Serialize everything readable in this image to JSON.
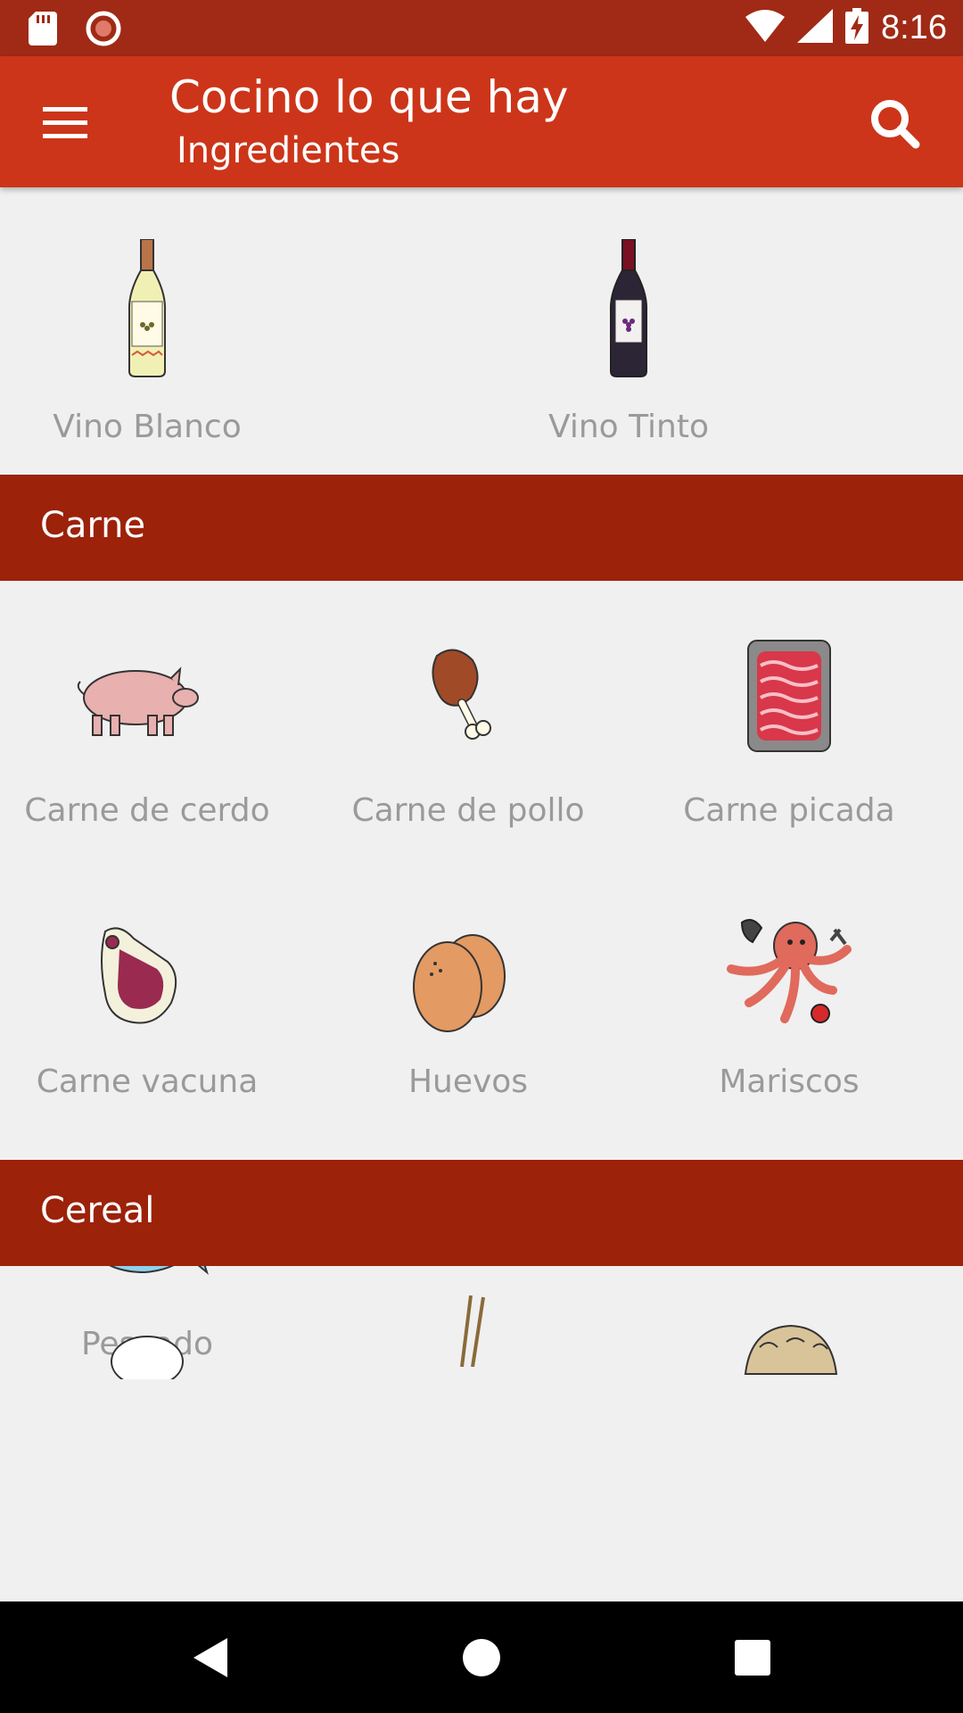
{
  "status_bar": {
    "time": "8:16",
    "icons": [
      "sd-card-icon",
      "recording-icon",
      "wifi-icon",
      "signal-icon",
      "battery-charging-icon"
    ]
  },
  "app_bar": {
    "title": "Cocino lo que hay",
    "subtitle": "Ingredientes",
    "menu_icon": "hamburger-menu-icon",
    "search_icon": "search-icon"
  },
  "top_items": [
    {
      "label": "Vino Blanco",
      "icon": "white-wine-bottle-icon"
    },
    {
      "label": "Vino Tinto",
      "icon": "red-wine-bottle-icon"
    }
  ],
  "sections": [
    {
      "title": "Carne",
      "items": [
        {
          "label": "Carne de cerdo",
          "icon": "pig-icon"
        },
        {
          "label": "Carne de pollo",
          "icon": "chicken-leg-icon"
        },
        {
          "label": "Carne picada",
          "icon": "ground-meat-icon"
        },
        {
          "label": "Carne vacuna",
          "icon": "beef-steak-icon"
        },
        {
          "label": "Huevos",
          "icon": "eggs-icon"
        },
        {
          "label": "Mariscos",
          "icon": "octopus-seafood-icon"
        },
        {
          "label": "Pescado",
          "icon": "fish-icon"
        }
      ]
    },
    {
      "title": "Cereal",
      "items": [
        {
          "label": "",
          "icon": "rice-bowl-icon"
        },
        {
          "label": "",
          "icon": "chopsticks-icon"
        },
        {
          "label": "",
          "icon": "bread-icon"
        }
      ]
    }
  ],
  "nav_bar": {
    "icons": [
      "back-icon",
      "home-icon",
      "recents-icon"
    ]
  },
  "colors": {
    "status_bar": "#a02a15",
    "app_bar": "#cc3519",
    "section_header": "#9c220a",
    "background": "#f0f0f0",
    "label": "#9a9a9a"
  }
}
